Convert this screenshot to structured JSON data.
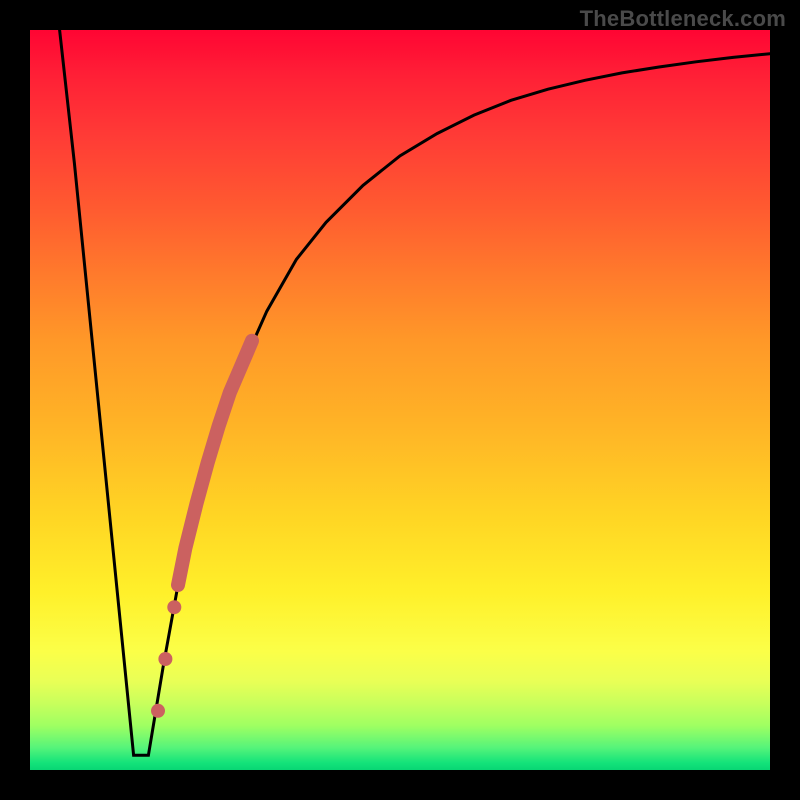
{
  "watermark": "TheBottleneck.com",
  "colors": {
    "frame": "#000000",
    "curve": "#000000",
    "marker": "#cb6160"
  },
  "chart_data": {
    "type": "line",
    "title": "",
    "xlabel": "",
    "ylabel": "",
    "xlim": [
      0,
      100
    ],
    "ylim": [
      0,
      100
    ],
    "grid": false,
    "legend": false,
    "series": [
      {
        "name": "bottleneck-curve",
        "x": [
          4,
          6,
          8,
          10,
          12,
          14,
          16,
          18,
          20,
          22,
          25,
          28,
          32,
          36,
          40,
          45,
          50,
          55,
          60,
          65,
          70,
          75,
          80,
          85,
          90,
          95,
          100
        ],
        "y": [
          100,
          82,
          62,
          42,
          22,
          2,
          2,
          14,
          25,
          34,
          45,
          53,
          62,
          69,
          74,
          79,
          83,
          86,
          88.5,
          90.5,
          92,
          93.2,
          94.2,
          95,
          95.7,
          96.3,
          96.8
        ]
      }
    ],
    "markers": [
      {
        "series": "highlight-dots",
        "x": 17.3,
        "y": 8,
        "r": 1.0
      },
      {
        "series": "highlight-dots",
        "x": 18.3,
        "y": 15,
        "r": 1.0
      },
      {
        "series": "highlight-dots",
        "x": 19.5,
        "y": 22,
        "r": 1.0
      }
    ],
    "thick_segment": {
      "series": "highlight-band",
      "x": [
        20.0,
        21.0,
        22.5,
        24.0,
        25.5,
        27.0,
        28.5,
        30.0
      ],
      "y": [
        25.0,
        30.0,
        36.0,
        41.5,
        46.5,
        51.0,
        54.5,
        58.0
      ]
    }
  }
}
